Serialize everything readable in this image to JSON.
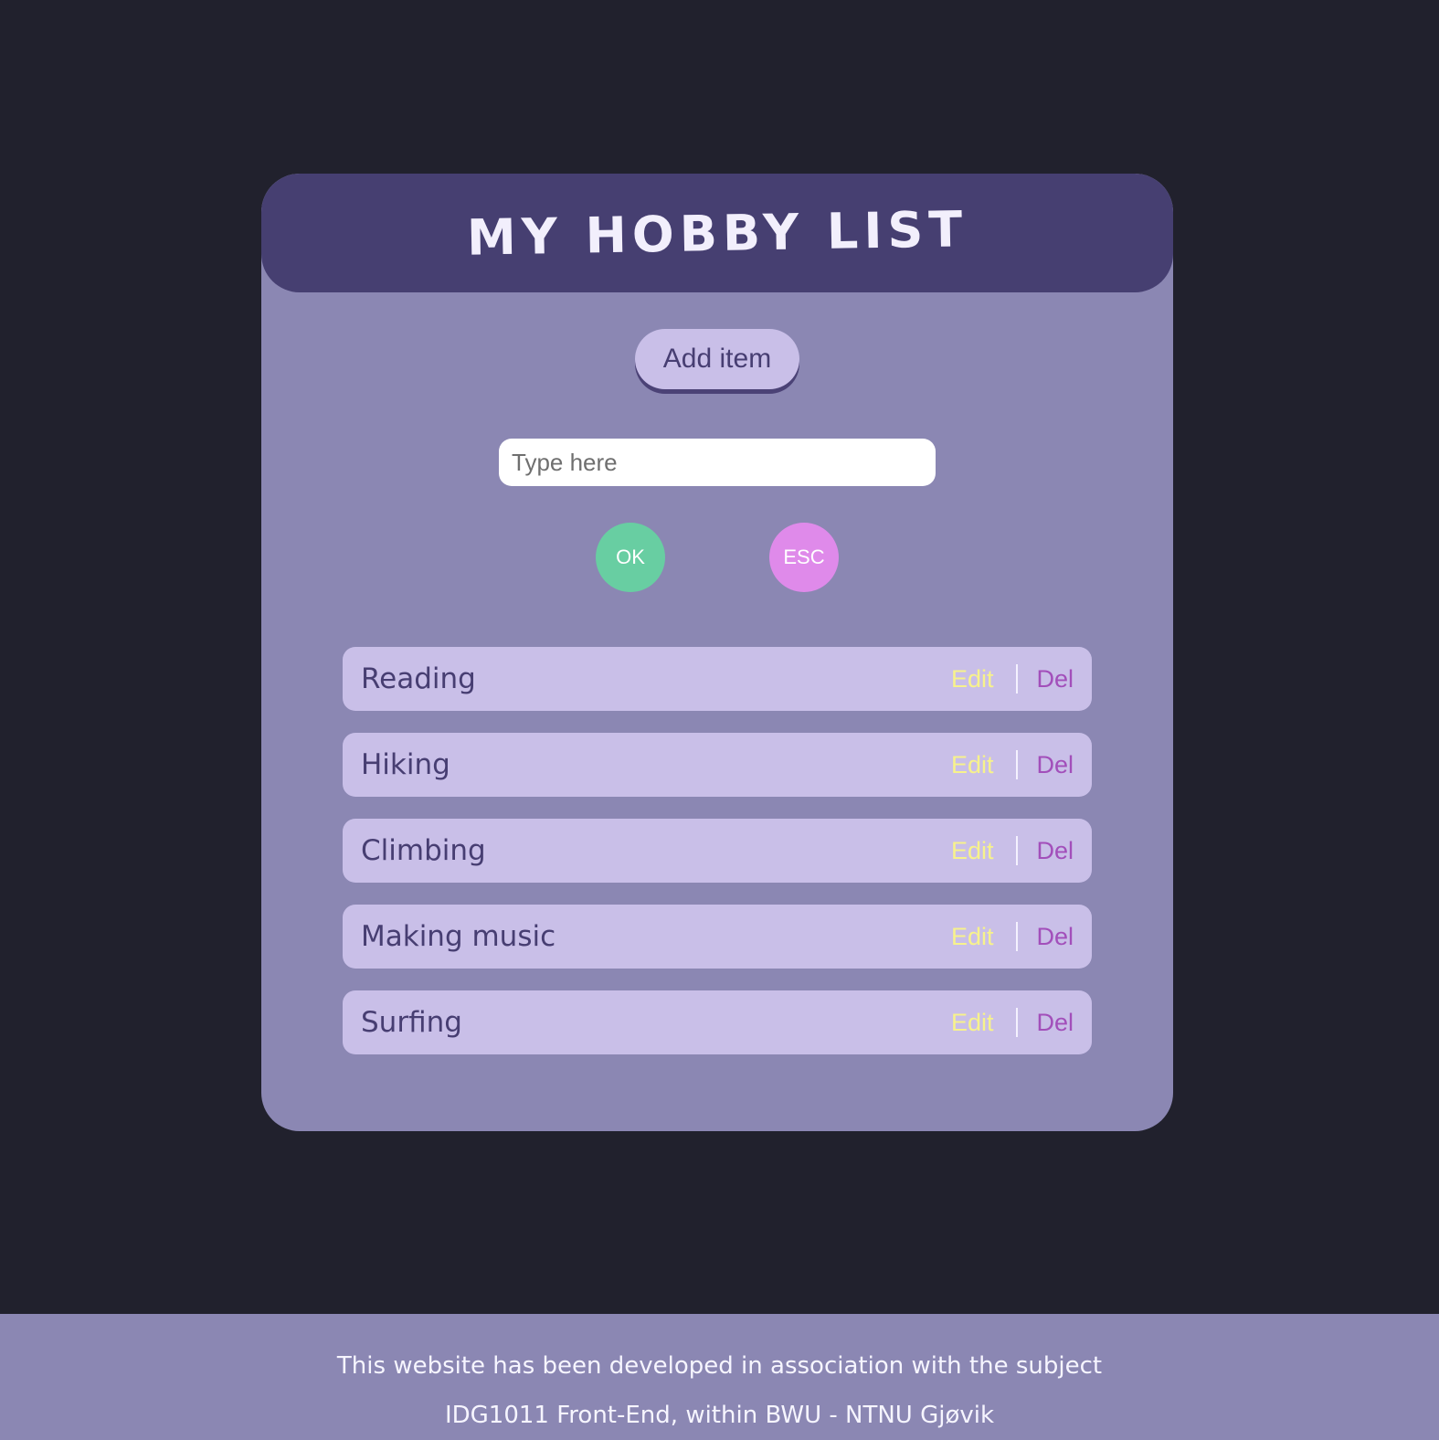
{
  "header": {
    "title": "My Hobby List"
  },
  "controls": {
    "add_button_label": "Add item",
    "input_placeholder": "Type here",
    "input_value": "",
    "ok_label": "OK",
    "esc_label": "ESC"
  },
  "hobbies": [
    {
      "name": "Reading",
      "edit_label": "Edit",
      "delete_label": "Del"
    },
    {
      "name": "Hiking",
      "edit_label": "Edit",
      "delete_label": "Del"
    },
    {
      "name": "Climbing",
      "edit_label": "Edit",
      "delete_label": "Del"
    },
    {
      "name": "Making music",
      "edit_label": "Edit",
      "delete_label": "Del"
    },
    {
      "name": "Surfing",
      "edit_label": "Edit",
      "delete_label": "Del"
    }
  ],
  "footer": {
    "line1": "This website has been developed in association with the subject",
    "line2": "IDG1011 Front-End, within BWU - NTNU Gjøvik"
  },
  "colors": {
    "background": "#21212d",
    "card": "#8b87b3",
    "header": "#463f71",
    "item": "#c9bfe8",
    "ok": "#68cea2",
    "esc": "#df8aea",
    "edit": "#f7f28c",
    "delete": "#a24fba"
  }
}
